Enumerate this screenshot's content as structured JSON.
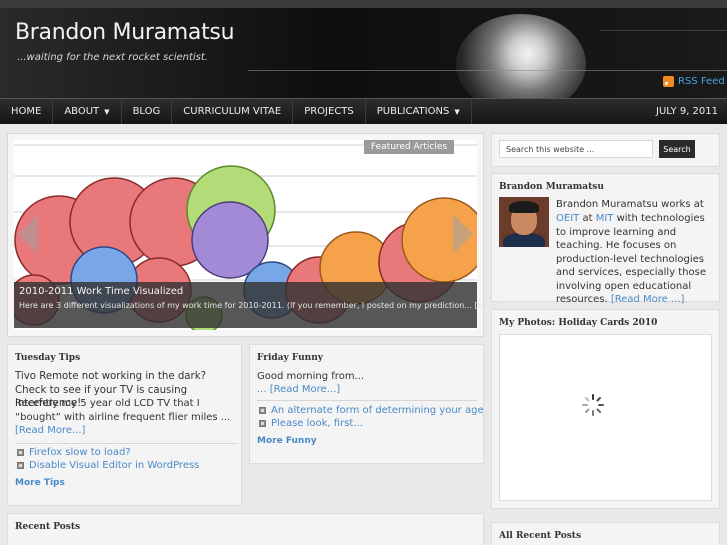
{
  "site": {
    "title": "Brandon Muramatsu",
    "tagline": "...waiting for the next rocket scientist.",
    "rss_label": "RSS Feed"
  },
  "nav": {
    "items": [
      {
        "label": "HOME",
        "dropdown": false
      },
      {
        "label": "ABOUT",
        "dropdown": true
      },
      {
        "label": "BLOG",
        "dropdown": false
      },
      {
        "label": "CURRICULUM VITAE",
        "dropdown": false
      },
      {
        "label": "PROJECTS",
        "dropdown": false
      },
      {
        "label": "PUBLICATIONS",
        "dropdown": true
      }
    ],
    "date": "JULY 9, 2011"
  },
  "featured": {
    "tag": "Featured Articles",
    "title": "2010-2011 Work Time Visualized",
    "excerpt": "Here are 3 different visualizations of my work time for 2010-2011. (If you remember, I posted on my prediction...",
    "more": "[more]"
  },
  "tuesday": {
    "title": "Tuesday Tips",
    "heading": "Tivo Remote not working in the dark? Check to see if your TV is causing interference!",
    "body": "Recently my 5 year old LCD TV that I “bought” with airline frequent flier miles ...",
    "read_more": "[Read More...]",
    "links": [
      "Firefox slow to load?",
      "Disable Visual Editor in WordPress"
    ],
    "more": "More Tips"
  },
  "friday": {
    "title": "Friday Funny",
    "body": "Good morning from...",
    "read_more": "... [Read More...]",
    "links": [
      "An alternate form of determining your age",
      "Please look, first..."
    ],
    "more": "More Funny"
  },
  "recent_posts": {
    "title": "Recent Posts"
  },
  "sidebar": {
    "search_placeholder": "Search this website ...",
    "search_button": "Search",
    "author": {
      "title": "Brandon Muramatsu",
      "bio_pre": "Brandon Muramatsu works at",
      "oeit": "OEIT",
      "at": "at",
      "mit": "MIT",
      "bio_post": "with technologies to improve learning and teaching. He focuses on production-level technologies and services, especially those involving open educational resources.",
      "read_more": "[Read More ...]"
    },
    "photos_title": "My Photos: Holiday Cards 2010",
    "all_recent_title": "All Recent Posts"
  },
  "colors": {
    "link": "#4a89c8",
    "header_bg": "#141414",
    "rss": "#f08a24"
  }
}
